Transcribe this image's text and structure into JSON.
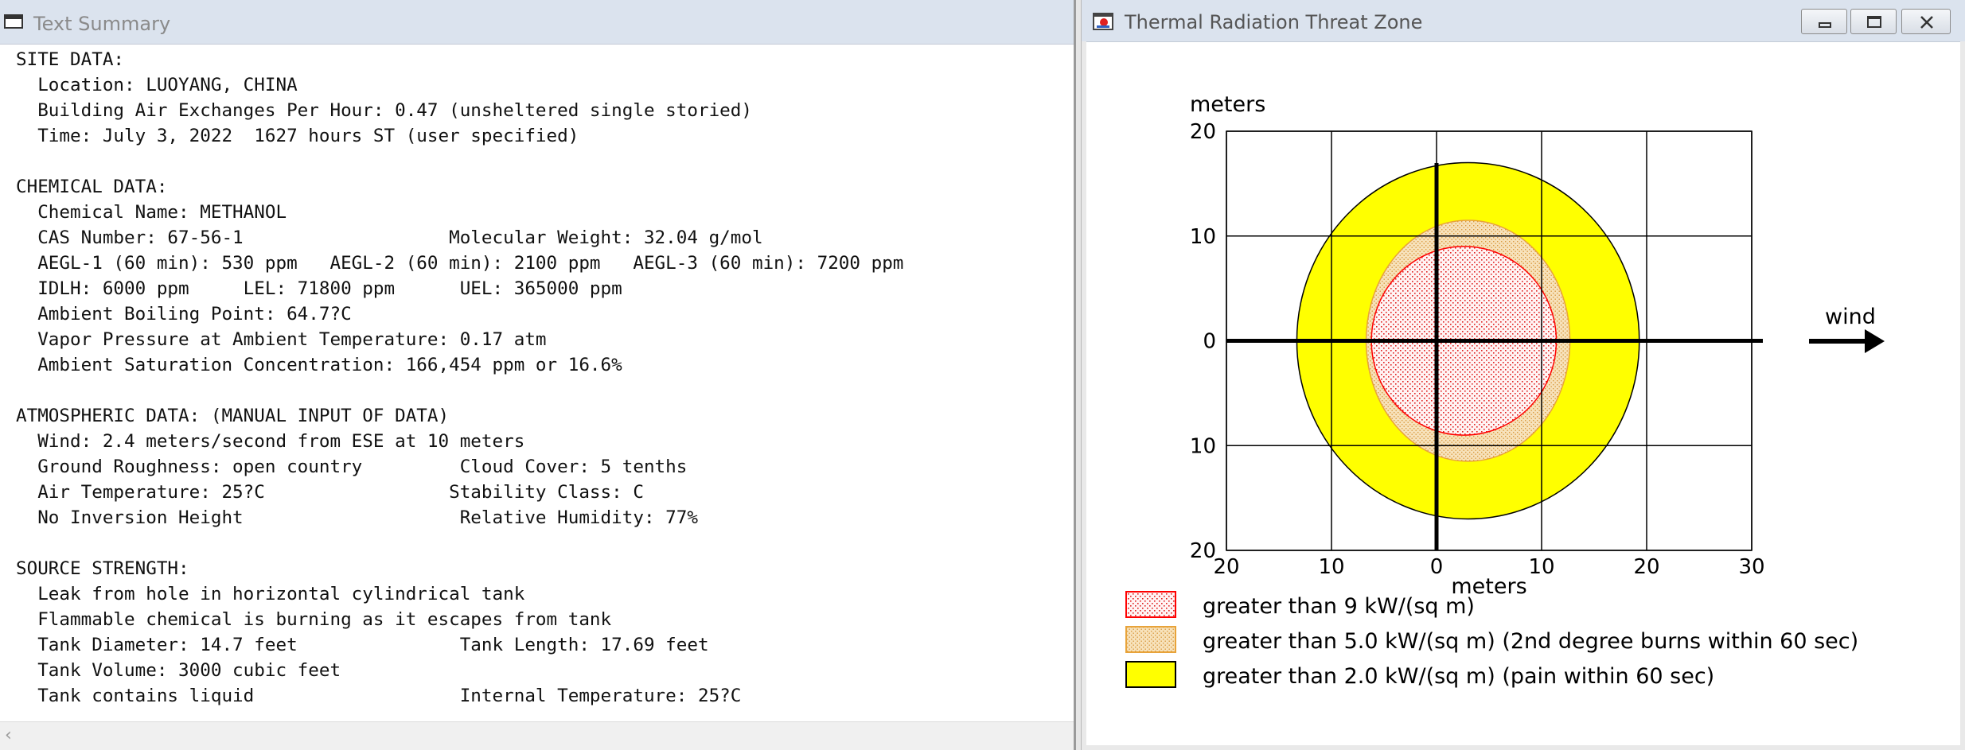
{
  "left_window": {
    "title": "Text Summary",
    "summary_lines": [
      "SITE DATA:",
      "  Location: LUOYANG, CHINA",
      "  Building Air Exchanges Per Hour: 0.47 (unsheltered single storied)",
      "  Time: July 3, 2022  1627 hours ST (user specified)",
      "",
      "CHEMICAL DATA:",
      "  Chemical Name: METHANOL",
      "  CAS Number: 67-56-1                   Molecular Weight: 32.04 g/mol",
      "  AEGL-1 (60 min): 530 ppm   AEGL-2 (60 min): 2100 ppm   AEGL-3 (60 min): 7200 ppm",
      "  IDLH: 6000 ppm     LEL: 71800 ppm      UEL: 365000 ppm",
      "  Ambient Boiling Point: 64.7?C",
      "  Vapor Pressure at Ambient Temperature: 0.17 atm",
      "  Ambient Saturation Concentration: 166,454 ppm or 16.6%",
      "",
      "ATMOSPHERIC DATA: (MANUAL INPUT OF DATA)",
      "  Wind: 2.4 meters/second from ESE at 10 meters",
      "  Ground Roughness: open country         Cloud Cover: 5 tenths",
      "  Air Temperature: 25?C                 Stability Class: C",
      "  No Inversion Height                    Relative Humidity: 77%",
      "",
      "SOURCE STRENGTH:",
      "  Leak from hole in horizontal cylindrical tank",
      "  Flammable chemical is burning as it escapes from tank",
      "  Tank Diameter: 14.7 feet               Tank Length: 17.69 feet",
      "  Tank Volume: 3000 cubic feet",
      "  Tank contains liquid                   Internal Temperature: 25?C"
    ]
  },
  "right_window": {
    "title": "Thermal Radiation Threat Zone",
    "buttons": {
      "minimize": "minimize",
      "maximize": "maximize",
      "close": "close"
    }
  },
  "chart_data": {
    "type": "area",
    "xlabel": "meters",
    "ylabel": "meters",
    "xlim": [
      -20,
      30
    ],
    "ylim": [
      -20,
      20
    ],
    "x_ticks": [
      -20,
      -10,
      0,
      10,
      20,
      30
    ],
    "x_tick_labels": [
      "20",
      "10",
      "0",
      "10",
      "20",
      "30"
    ],
    "y_ticks": [
      20,
      10,
      0,
      -10,
      -20
    ],
    "y_tick_labels": [
      "20",
      "10",
      "0",
      "10",
      "20"
    ],
    "grid": true,
    "wind_label": "wind",
    "wind_direction": "east",
    "zones": [
      {
        "name": "greater than 2.0 kW/(sq m) (pain within 60 sec)",
        "center_x": 3,
        "center_y": 0,
        "radius_x": 16.3,
        "radius_y": 17,
        "fill": "#ffff00",
        "stroke": "#000000",
        "pattern": "solid"
      },
      {
        "name": "greater than 5.0 kW/(sq m) (2nd degree burns within 60 sec)",
        "center_x": 3,
        "center_y": 0,
        "radius_x": 9.7,
        "radius_y": 11.5,
        "fill": "#f5deb3",
        "stroke": "#e8a33a",
        "pattern": "dots"
      },
      {
        "name": "greater than 9 kW/(sq m)",
        "center_x": 2.6,
        "center_y": 0,
        "radius_x": 8.8,
        "radius_y": 9,
        "fill": "#fff2f2",
        "stroke": "#ff0000",
        "pattern": "red-dots"
      }
    ],
    "legend": [
      {
        "label": "greater than 9 kW/(sq m)",
        "pattern": "red-dots"
      },
      {
        "label": "greater than 5.0 kW/(sq m) (2nd degree burns within 60 sec)",
        "pattern": "dots"
      },
      {
        "label": "greater than 2.0 kW/(sq m) (pain within 60 sec)",
        "pattern": "solid"
      }
    ]
  }
}
